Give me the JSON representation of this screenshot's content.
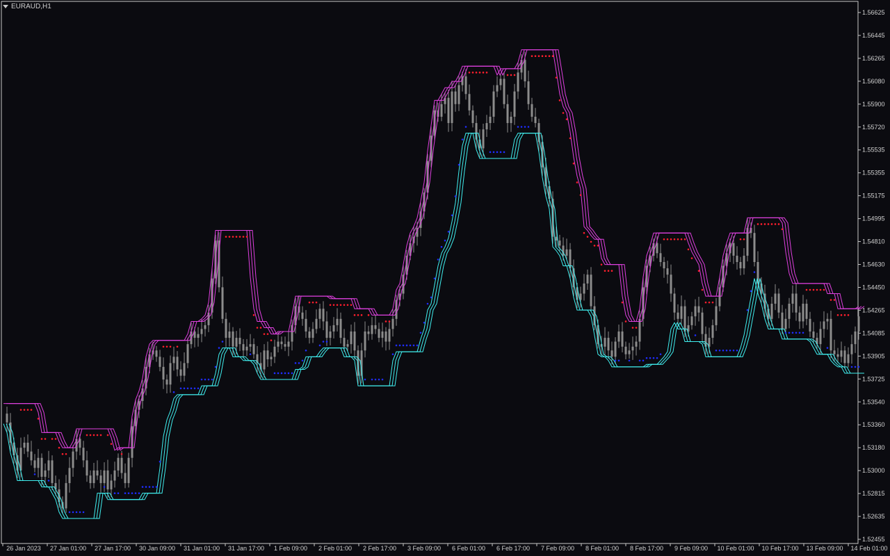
{
  "window": {
    "title": "EURAUD,H1"
  },
  "colors": {
    "background": "#0b0b10",
    "frame": "#c8c8c8",
    "text": "#d0d0d0",
    "candle": "#8c8c8c",
    "lower_trail": "#1f2dff",
    "upper_trail": "#ff1e2d",
    "band_magenta": "#e040e0",
    "band_cyan": "#40f0f0"
  },
  "chart_data": {
    "type": "line",
    "symbol": "EURAUD",
    "timeframe": "H1",
    "price_axis": {
      "min": 1.52455,
      "max": 1.56625,
      "ticks": [
        "1.56625",
        "1.56445",
        "1.56265",
        "1.56080",
        "1.55900",
        "1.55720",
        "1.55535",
        "1.55355",
        "1.55175",
        "1.54995",
        "1.54810",
        "1.54630",
        "1.54450",
        "1.54265",
        "1.54085",
        "1.53905",
        "1.53725",
        "1.53540",
        "1.53360",
        "1.53180",
        "1.53000",
        "1.52815",
        "1.52635",
        "1.52455"
      ]
    },
    "time_axis": {
      "labels": [
        "26 Jan 2023",
        "27 Jan 01:00",
        "27 Jan 17:00",
        "30 Jan 09:00",
        "31 Jan 01:00",
        "31 Jan 17:00",
        "1 Feb 09:00",
        "2 Feb 01:00",
        "2 Feb 17:00",
        "3 Feb 09:00",
        "6 Feb 01:00",
        "6 Feb 17:00",
        "7 Feb 09:00",
        "8 Feb 01:00",
        "8 Feb 17:00",
        "9 Feb 09:00",
        "10 Feb 01:00",
        "10 Feb 17:00",
        "13 Feb 09:00",
        "14 Feb 01:00"
      ]
    },
    "series": [
      {
        "role": "price-close",
        "x": [
          0,
          5,
          10,
          15,
          20,
          25,
          30,
          35,
          40,
          45,
          50,
          55,
          60,
          65,
          70,
          75,
          80,
          85,
          90,
          95,
          100,
          105,
          110,
          115,
          120,
          125,
          130,
          135,
          140,
          145,
          150,
          155,
          160,
          165,
          170,
          175,
          180,
          185,
          190,
          195,
          200,
          205,
          210,
          215,
          220,
          225,
          230,
          235,
          240,
          245,
          250,
          255,
          260,
          265,
          270,
          275,
          280,
          285,
          290,
          295,
          300,
          305,
          310,
          315,
          320,
          325,
          330,
          335,
          340,
          345,
          350,
          355,
          360,
          365,
          370,
          375,
          380,
          385,
          390,
          395,
          400,
          405,
          410,
          415,
          420,
          425,
          430,
          435,
          440,
          445,
          450,
          455,
          460,
          465,
          470,
          475,
          480,
          485,
          490,
          495,
          500,
          505,
          510,
          515,
          520,
          525,
          530,
          535,
          540,
          545,
          550,
          555,
          560,
          565,
          570,
          575,
          580,
          585,
          590,
          595,
          600,
          605,
          610,
          615,
          620,
          625,
          630,
          635,
          640,
          645,
          650,
          655,
          660,
          665,
          670,
          675,
          680,
          685,
          690,
          695,
          700,
          705,
          710,
          715,
          720,
          725,
          730,
          735,
          740,
          745,
          750,
          755,
          760,
          765,
          770,
          775,
          780,
          785,
          790,
          795,
          800,
          805,
          810,
          815,
          820,
          825,
          830,
          835,
          840,
          845,
          850,
          855,
          860,
          865,
          870,
          875,
          880,
          885,
          890,
          895,
          900,
          905,
          910,
          915,
          920,
          925,
          930,
          935,
          940,
          945,
          950,
          955,
          960,
          965,
          970,
          975,
          980,
          985,
          990,
          995,
          1000,
          1005,
          1010,
          1015,
          1020,
          1025,
          1030,
          1035,
          1040,
          1045,
          1050,
          1055,
          1060,
          1065,
          1070,
          1075,
          1080,
          1085,
          1090,
          1095,
          1100,
          1105,
          1110,
          1115,
          1120,
          1125,
          1130,
          1135,
          1140,
          1145,
          1150,
          1155,
          1160,
          1165,
          1170,
          1175,
          1180,
          1185,
          1190,
          1195,
          1200,
          1205,
          1210,
          1215,
          1220,
          1225,
          1230
        ],
        "values": [
          1.5345,
          1.5338,
          1.5322,
          1.5312,
          1.53,
          1.5318,
          1.5322,
          1.5315,
          1.5308,
          1.5302,
          1.531,
          1.5295,
          1.53,
          1.5308,
          1.529,
          1.5285,
          1.5275,
          1.527,
          1.529,
          1.5302,
          1.5315,
          1.5325,
          1.5318,
          1.5308,
          1.5296,
          1.529,
          1.53,
          1.5296,
          1.529,
          1.53,
          1.5285,
          1.5292,
          1.53,
          1.531,
          1.5298,
          1.529,
          1.531,
          1.5335,
          1.5348,
          1.5355,
          1.5365,
          1.5382,
          1.5392,
          1.5395,
          1.539,
          1.5382,
          1.5372,
          1.5368,
          1.5385,
          1.539,
          1.538,
          1.5375,
          1.5385,
          1.54,
          1.541,
          1.5405,
          1.5408,
          1.5412,
          1.5415,
          1.5425,
          1.5452,
          1.5482,
          1.5445,
          1.542,
          1.5405,
          1.541,
          1.5398,
          1.5405,
          1.54,
          1.5395,
          1.5398,
          1.54,
          1.5392,
          1.5385,
          1.538,
          1.5395,
          1.5388,
          1.539,
          1.5398,
          1.5402,
          1.54,
          1.5398,
          1.5402,
          1.5415,
          1.543,
          1.5425,
          1.542,
          1.541,
          1.5405,
          1.5412,
          1.542,
          1.5428,
          1.5418,
          1.5405,
          1.541,
          1.5415,
          1.542,
          1.5405,
          1.5398,
          1.54,
          1.541,
          1.5395,
          1.5375,
          1.5395,
          1.541,
          1.5408,
          1.5415,
          1.5412,
          1.5405,
          1.541,
          1.5402,
          1.5412,
          1.542,
          1.5435,
          1.544,
          1.5455,
          1.547,
          1.548,
          1.5485,
          1.5492,
          1.5505,
          1.552,
          1.5545,
          1.5565,
          1.5585,
          1.558,
          1.559,
          1.5595,
          1.5575,
          1.56,
          1.559,
          1.5605,
          1.5612,
          1.5598,
          1.5585,
          1.5575,
          1.5562,
          1.5555,
          1.557,
          1.5575,
          1.558,
          1.56,
          1.5605,
          1.561,
          1.559,
          1.5575,
          1.558,
          1.56,
          1.5615,
          1.5625,
          1.5608,
          1.559,
          1.558,
          1.5575,
          1.556,
          1.554,
          1.5525,
          1.5515,
          1.5485,
          1.5482,
          1.5478,
          1.547,
          1.5475,
          1.546,
          1.5445,
          1.5435,
          1.544,
          1.5448,
          1.5455,
          1.543,
          1.5415,
          1.54,
          1.5398,
          1.5405,
          1.5395,
          1.539,
          1.5402,
          1.541,
          1.5398,
          1.5392,
          1.5395,
          1.5398,
          1.5402,
          1.542,
          1.5445,
          1.5462,
          1.547,
          1.548,
          1.5472,
          1.5465,
          1.546,
          1.5455,
          1.544,
          1.5425,
          1.542,
          1.543,
          1.541,
          1.5415,
          1.5422,
          1.543,
          1.5425,
          1.5408,
          1.5398,
          1.5405,
          1.5415,
          1.543,
          1.5445,
          1.5462,
          1.5472,
          1.548,
          1.547,
          1.5465,
          1.546,
          1.547,
          1.5492,
          1.5488,
          1.5465,
          1.5448,
          1.544,
          1.5428,
          1.542,
          1.5432,
          1.544,
          1.5425,
          1.5412,
          1.542,
          1.5432,
          1.544,
          1.5425,
          1.5418,
          1.5432,
          1.542,
          1.541,
          1.5405,
          1.54,
          1.5412,
          1.5418,
          1.542,
          1.5395,
          1.5392,
          1.539,
          1.5395,
          1.5385,
          1.5392,
          1.54,
          1.541,
          1.5422
        ]
      }
    ]
  }
}
